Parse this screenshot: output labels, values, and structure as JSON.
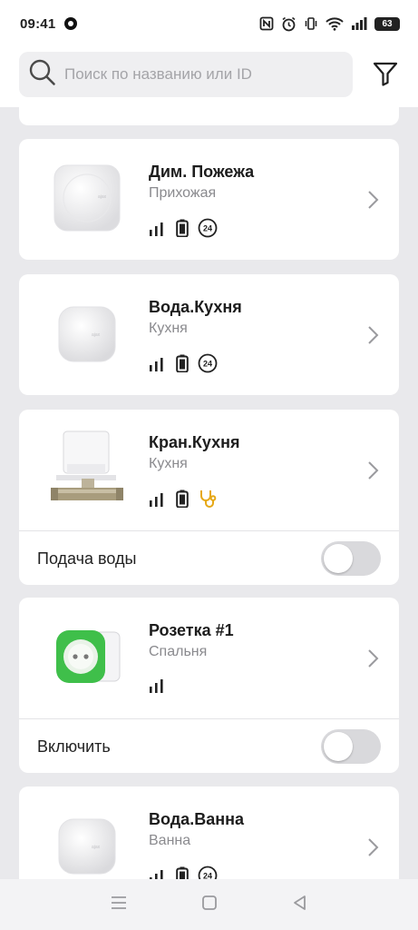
{
  "status_bar": {
    "time": "09:41",
    "battery": "63",
    "icons": [
      "nfc-icon",
      "alarm-icon",
      "vibrate-icon",
      "wifi-icon",
      "signal-icon",
      "battery-icon"
    ]
  },
  "search": {
    "placeholder": "Поиск по названию или ID",
    "value": ""
  },
  "devices": [
    {
      "name": "Дим. Пожежа",
      "room": "Прихожая",
      "icons": [
        "signal-icon",
        "battery-icon",
        "24h-icon"
      ]
    },
    {
      "name": "Вода.Кухня",
      "room": "Кухня",
      "icons": [
        "signal-icon",
        "battery-icon",
        "24h-icon"
      ]
    },
    {
      "name": "Кран.Кухня",
      "room": "Кухня",
      "icons": [
        "signal-icon",
        "battery-icon",
        "stethoscope-icon"
      ],
      "toggle_label": "Подача воды",
      "toggle_on": false
    },
    {
      "name": "Розетка #1",
      "room": "Спальня",
      "icons": [
        "signal-icon"
      ],
      "toggle_label": "Включить",
      "toggle_on": false
    },
    {
      "name": "Вода.Ванна",
      "room": "Ванна",
      "icons": [
        "signal-icon",
        "battery-icon",
        "24h-icon"
      ]
    }
  ],
  "colors": {
    "accent_warning": "#e6a817",
    "socket_led": "#3fbf4a"
  },
  "nav": [
    "menu-icon",
    "home-icon",
    "back-icon"
  ]
}
